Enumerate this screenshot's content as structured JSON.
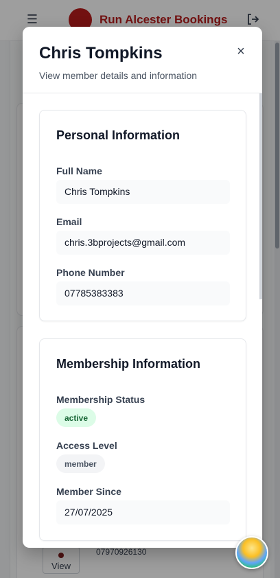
{
  "app": {
    "title": "Run Alcester Bookings"
  },
  "background": {
    "row_phone": "07970926130",
    "view_label": "View"
  },
  "modal": {
    "title": "Chris Tompkins",
    "subtitle": "View member details and information",
    "close_label": "×"
  },
  "personal": {
    "title": "Personal Information",
    "full_name_label": "Full Name",
    "full_name": "Chris Tompkins",
    "email_label": "Email",
    "email": "chris.3bprojects@gmail.com",
    "phone_label": "Phone Number",
    "phone": "07785383383"
  },
  "membership": {
    "title": "Membership Information",
    "status_label": "Membership Status",
    "status": "active",
    "access_label": "Access Level",
    "access": "member",
    "since_label": "Member Since",
    "since": "27/07/2025"
  },
  "colors": {
    "brand": "#b91c1c",
    "status_active_bg": "#dcfce7",
    "status_active_text": "#166534"
  },
  "icons": {
    "menu": "menu-icon",
    "logout": "logout-icon",
    "close": "close-icon",
    "avatar": "avatar-icon"
  }
}
